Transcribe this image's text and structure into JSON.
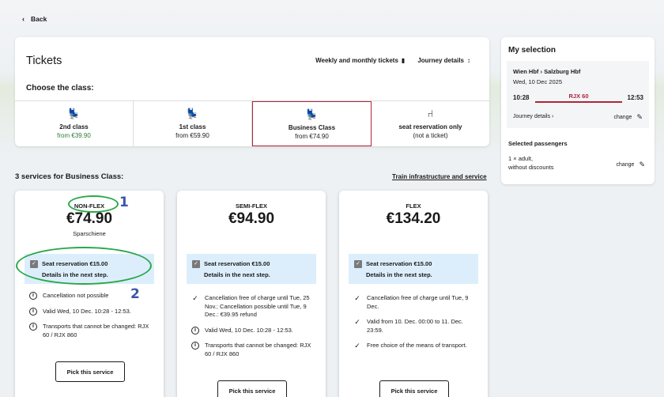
{
  "nav": {
    "back_label": "Back",
    "back_icon": "chevron-left-icon"
  },
  "tickets": {
    "title": "Tickets",
    "weekly_label": "Weekly and monthly tickets",
    "journey_label": "Journey details",
    "choose_label": "Choose the class:",
    "classes": [
      {
        "name": "2nd class",
        "price": "from €39.90",
        "icon": "seat-icon"
      },
      {
        "name": "1st class",
        "price": "from €59.90",
        "icon": "seat-icon"
      },
      {
        "name": "Business Class",
        "price": "from €74.90",
        "icon": "seat-icon",
        "selected": true
      },
      {
        "name": "seat reservation only",
        "price": "(not a ticket)",
        "icon": "seat-outline-icon"
      }
    ]
  },
  "services": {
    "title": "3 services for Business Class:",
    "infra_link": "Train infrastructure and service",
    "cards": [
      {
        "tier": "NON-FLEX",
        "price": "€74.90",
        "subtitle": "Sparschiene",
        "seat_title": "Seat reservation €15.00",
        "seat_details": "Details in the next step.",
        "items": [
          {
            "icon": "info-icon",
            "text": "Cancellation not possible"
          },
          {
            "icon": "info-icon",
            "text": "Valid Wed, 10 Dec. 10:28 - 12:53."
          },
          {
            "icon": "info-icon",
            "text": "Transports that cannot be changed: RJX 60 / RJX 860"
          }
        ],
        "button": "Pick this service"
      },
      {
        "tier": "SEMI-FLEX",
        "price": "€94.90",
        "subtitle": "",
        "seat_title": "Seat reservation €15.00",
        "seat_details": "Details in the next step.",
        "items": [
          {
            "icon": "check-icon",
            "text": "Cancellation free of charge until Tue, 25 Nov.; Cancellation possible until Tue, 9 Dec.: €39.95 refund"
          },
          {
            "icon": "info-icon",
            "text": "Valid Wed, 10 Dec. 10:28 - 12:53."
          },
          {
            "icon": "info-icon",
            "text": "Transports that cannot be changed: RJX 60 / RJX 860"
          }
        ],
        "button": "Pick this service"
      },
      {
        "tier": "FLEX",
        "price": "€134.20",
        "subtitle": "",
        "seat_title": "Seat reservation €15.00",
        "seat_details": "Details in the next step.",
        "items": [
          {
            "icon": "check-icon",
            "text": "Cancellation free of charge until Tue, 9 Dec."
          },
          {
            "icon": "check-icon",
            "text": "Valid from 10. Dec. 00:00 to 11. Dec. 23:59."
          },
          {
            "icon": "check-icon",
            "text": "Free choice of the means of transport."
          }
        ],
        "button": "Pick this service"
      }
    ]
  },
  "selection": {
    "title": "My selection",
    "route": "Wien Hbf › Salzburg Hbf",
    "date": "Wed, 10 Dec 2025",
    "dep": "10:28",
    "train": "RJX 60",
    "arr": "12:53",
    "journey_details": "Journey details ›",
    "change_label": "change",
    "passengers_title": "Selected passengers",
    "passenger_line1": "1 × adult,",
    "passenger_line2": "without discounts",
    "change_label2": "change"
  },
  "annotations": {
    "one": "1",
    "two": "2",
    "color": "#2aa84a",
    "num_color": "#3b56a8"
  },
  "colors": {
    "accent": "#b0243a",
    "price_green": "#2e7d32",
    "seat_bg": "#dceefb"
  }
}
